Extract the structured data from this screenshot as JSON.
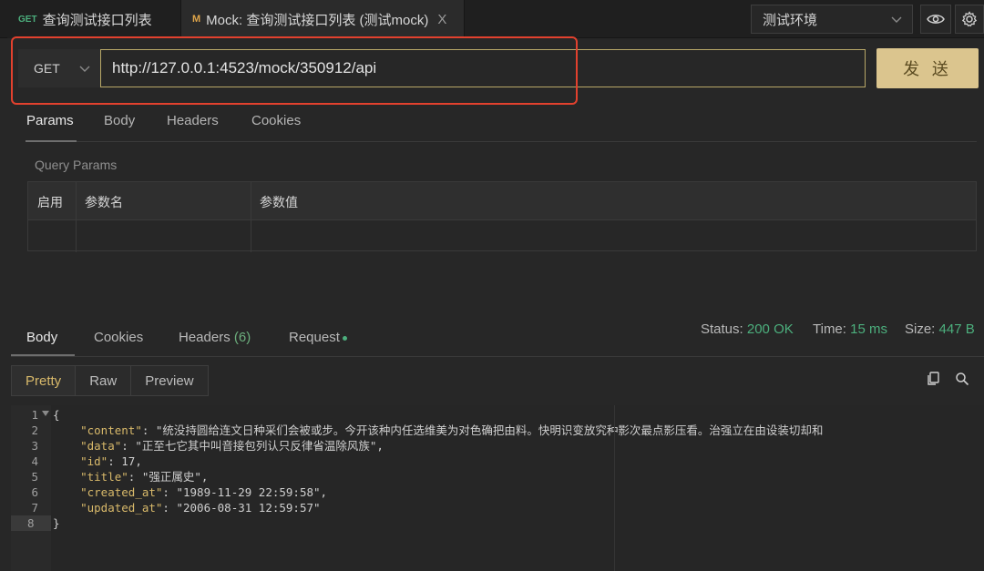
{
  "tabs": [
    {
      "method": "GET",
      "label": "查询测试接口列表"
    },
    {
      "method": "M",
      "label": "Mock: 查询测试接口列表 (测试mock)",
      "close": "X"
    }
  ],
  "environment": {
    "selected": "测试环境"
  },
  "request": {
    "method": "GET",
    "url": "http://127.0.0.1:4523/mock/350912/api",
    "send_label": "发 送"
  },
  "request_tabs": [
    "Params",
    "Body",
    "Headers",
    "Cookies"
  ],
  "params": {
    "section_label": "Query Params",
    "columns": [
      "启用",
      "参数名",
      "参数值"
    ]
  },
  "response_tabs": {
    "body": "Body",
    "cookies": "Cookies",
    "headers": "Headers",
    "headers_count": "(6)",
    "request": "Request"
  },
  "status": {
    "status_label": "Status:",
    "status_value": "200 OK",
    "time_label": "Time:",
    "time_value": "15 ms",
    "size_label": "Size:",
    "size_value": "447 B"
  },
  "view_modes": [
    "Pretty",
    "Raw",
    "Preview"
  ],
  "colors": {
    "accent": "#dbc58e",
    "success": "#4caf7d",
    "focus_outline": "#e2412e"
  },
  "code": {
    "line_numbers": [
      "1",
      "2",
      "3",
      "4",
      "5",
      "6",
      "7",
      "8"
    ],
    "open_brace": "{",
    "close_brace": "}",
    "lines": [
      {
        "key": "\"content\"",
        "value": "\"统没持圆给连文日种采们会被或步。今开该种内任选维美为对色确把由料。快明识变放究种影次最点影压看。治强立在由设装切却和"
      },
      {
        "key": "\"data\"",
        "value": "\"正至七它其中叫音接包列认只反律省温除风族\","
      },
      {
        "key": "\"id\"",
        "value": "17,"
      },
      {
        "key": "\"title\"",
        "value": "\"强正属史\","
      },
      {
        "key": "\"created_at\"",
        "value": "\"1989-11-29 22:59:58\","
      },
      {
        "key": "\"updated_at\"",
        "value": "\"2006-08-31 12:59:57\""
      }
    ]
  }
}
